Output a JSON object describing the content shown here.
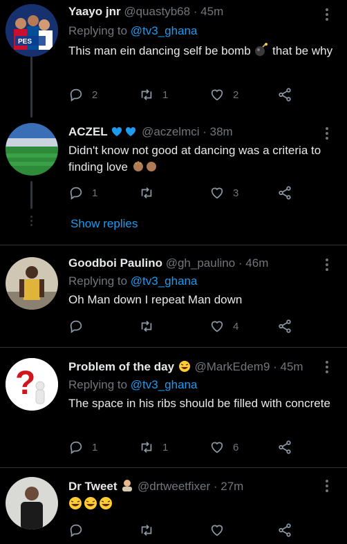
{
  "tweets": [
    {
      "name": "Yaayo jnr",
      "handle": "@quastyb68",
      "time": "· 45m",
      "replying_prefix": "Replying to ",
      "replying_to": "@tv3_ghana",
      "text": "This man ein dancing self be bomb",
      "text2": " that be why",
      "avatar_badge": "PES",
      "replies": "2",
      "retweets": "1",
      "likes": "2"
    },
    {
      "name": "ACZEL",
      "handle": "@aczelmci",
      "time": "· 38m",
      "text": "Didn't know not good at dancing was a criteria to finding love",
      "replies": "1",
      "retweets": "",
      "likes": "3"
    },
    {
      "name": "Goodboi Paulino",
      "handle": "@gh_paulino",
      "time": "· 46m",
      "replying_prefix": "Replying to ",
      "replying_to": "@tv3_ghana",
      "text": "Oh Man down I repeat Man down",
      "replies": "",
      "retweets": "",
      "likes": "4"
    },
    {
      "name": "Problem of the day",
      "handle": "@MarkEdem9",
      "time": "· 45m",
      "replying_prefix": "Replying to ",
      "replying_to": "@tv3_ghana",
      "text": "The space in his ribs should be filled with concrete",
      "replies": "1",
      "retweets": "1",
      "likes": "6"
    },
    {
      "name": "Dr Tweet",
      "handle": "@drtweetfixer",
      "time": "· 27m",
      "text": "😂😂😂",
      "replies": "",
      "retweets": "",
      "likes": ""
    }
  ],
  "show_replies": "Show replies",
  "colors": {
    "accent": "#1d9bf0",
    "heart_blue": "#1d9bf0",
    "muted": "#71767b"
  }
}
